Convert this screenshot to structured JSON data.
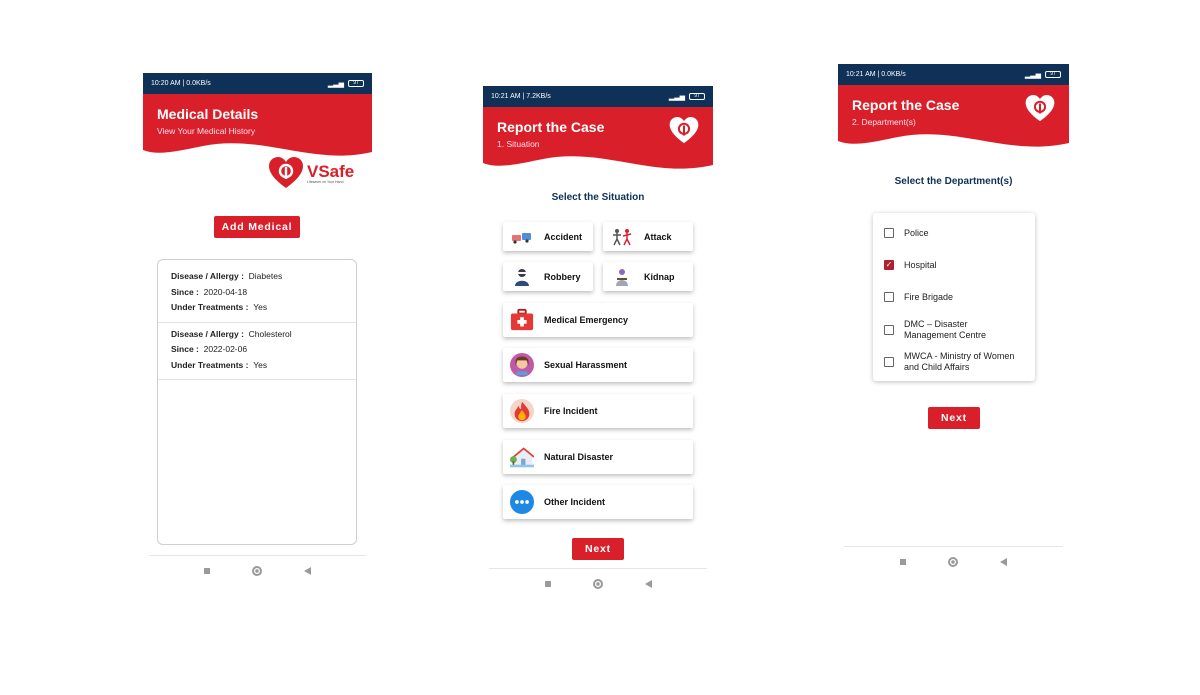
{
  "medical_screen": {
    "status": {
      "time": "10:20 AM | 0.0KB/s",
      "battery": "97"
    },
    "header": {
      "title": "Medical Details",
      "subtitle": "View Your Medical History"
    },
    "brand": {
      "name": "VSafe",
      "tagline": "Lifesaver on Your Hand"
    },
    "add_button": "Add Medical",
    "records": [
      {
        "disease_label": "Disease / Allergy :",
        "disease": "Diabetes",
        "since_label": "Since :",
        "since": "2020-04-18",
        "treat_label": "Under Treatments :",
        "treat": "Yes"
      },
      {
        "disease_label": "Disease / Allergy :",
        "disease": "Cholesterol",
        "since_label": "Since :",
        "since": "2022-02-06",
        "treat_label": "Under Treatments :",
        "treat": "Yes"
      }
    ]
  },
  "situation_screen": {
    "status": {
      "time": "10:21 AM | 7.2KB/s",
      "battery": "97"
    },
    "header": {
      "title": "Report the Case",
      "subtitle": "1. Situation"
    },
    "section_title": "Select the Situation",
    "small_options": [
      {
        "label": "Accident",
        "icon": "car-crash-icon"
      },
      {
        "label": "Attack",
        "icon": "attack-icon"
      },
      {
        "label": "Robbery",
        "icon": "robber-icon"
      },
      {
        "label": "Kidnap",
        "icon": "kidnap-icon"
      }
    ],
    "wide_options": [
      {
        "label": "Medical Emergency",
        "icon": "first-aid-kit-icon"
      },
      {
        "label": "Sexual Harassment",
        "icon": "harassment-icon"
      },
      {
        "label": "Fire Incident",
        "icon": "fire-icon"
      },
      {
        "label": "Natural Disaster",
        "icon": "house-flood-icon"
      },
      {
        "label": "Other Incident",
        "icon": "more-dots-icon"
      }
    ],
    "next_button": "Next"
  },
  "department_screen": {
    "status": {
      "time": "10:21 AM | 0.0KB/s",
      "battery": "97"
    },
    "header": {
      "title": "Report the Case",
      "subtitle": "2. Department(s)"
    },
    "section_title": "Select the Department(s)",
    "departments": [
      {
        "line1": "Police",
        "line2": "",
        "checked": false
      },
      {
        "line1": "Hospital",
        "line2": "",
        "checked": true
      },
      {
        "line1": "Fire Brigade",
        "line2": "",
        "checked": false
      },
      {
        "line1": "DMC – Disaster",
        "line2": "Management Centre",
        "checked": false
      },
      {
        "line1": "MWCA - Ministry of Women",
        "line2": "and Child Affairs",
        "checked": false
      }
    ],
    "next_button": "Next"
  },
  "colors": {
    "brand_red": "#d9202a",
    "status_bar": "#0f3057",
    "check_red": "#b0202e"
  }
}
